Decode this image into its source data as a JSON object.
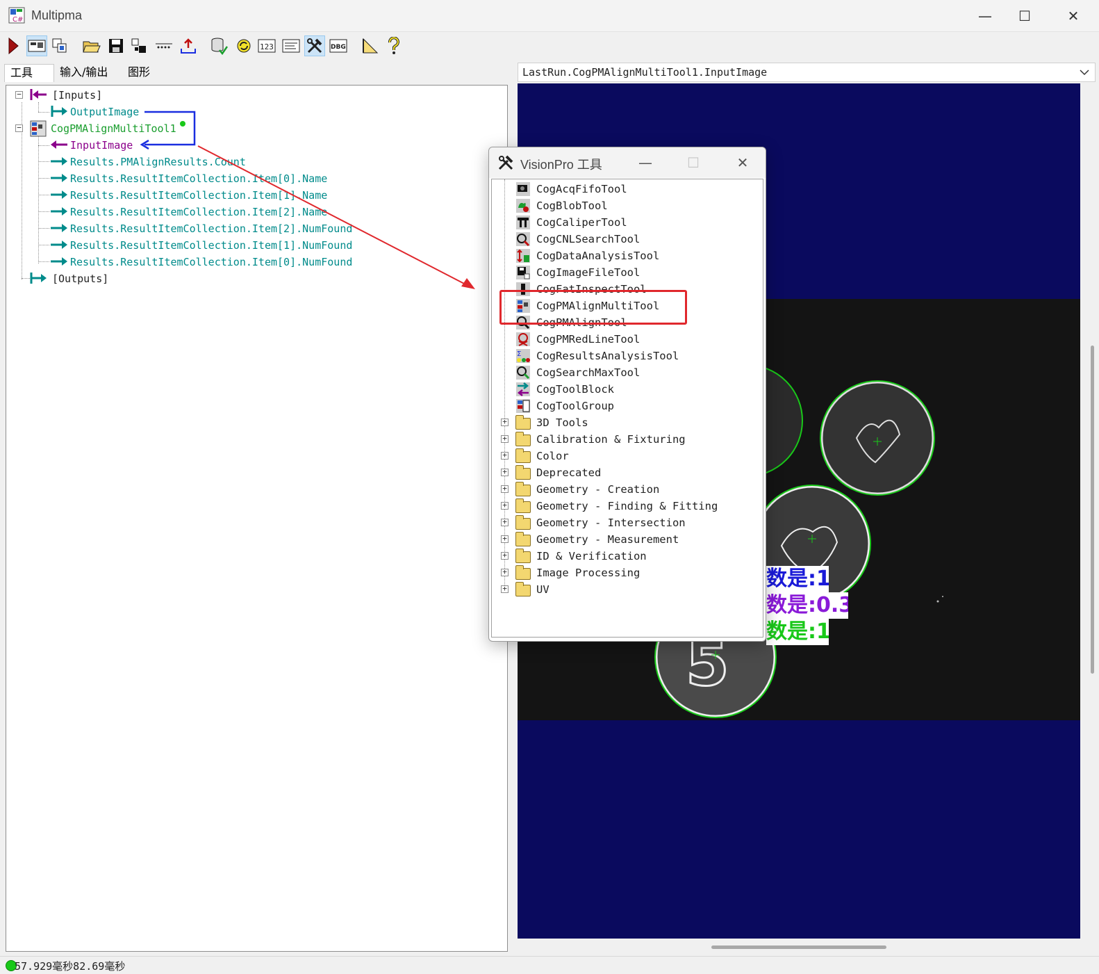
{
  "window": {
    "title": "Multipma",
    "minimize": "—",
    "maximize": "☐",
    "close": "✕"
  },
  "toolbar": {
    "buttons": [
      "run-icon",
      "live-display-icon",
      "copy-icon",
      "open-icon",
      "save-icon",
      "reset-icon",
      "dots-icon",
      "import-icon",
      "database-icon",
      "refresh-icon",
      "number-icon",
      "text-icon",
      "tools-icon",
      "debug-icon",
      "measure-icon",
      "help-icon"
    ],
    "text_123": "123",
    "text_dbg": "DBG"
  },
  "tabs": [
    "工具",
    "输入/输出",
    "图形"
  ],
  "tree": {
    "inputs": "[Inputs]",
    "output_image": "OutputImage",
    "tool": "CogPMAlignMultiTool1",
    "input_image": "InputImage",
    "results": [
      "Results.PMAlignResults.Count",
      "Results.ResultItemCollection.Item[0].Name",
      "Results.ResultItemCollection.Item[1].Name",
      "Results.ResultItemCollection.Item[2].Name",
      "Results.ResultItemCollection.Item[2].NumFound",
      "Results.ResultItemCollection.Item[1].NumFound",
      "Results.ResultItemCollection.Item[0].NumFound"
    ],
    "outputs": "[Outputs]"
  },
  "viewer": {
    "title": "LastRun.CogPMAlignMultiTool1.InputImage",
    "overlay": [
      {
        "text": "数是:1",
        "color": "#1a1ad8"
      },
      {
        "text": "数是:0.3",
        "color": "#8a1ad8"
      },
      {
        "text": "数是:1",
        "color": "#19c819"
      }
    ]
  },
  "status": {
    "text": "57.929毫秒82.69毫秒",
    "color": "#19c819"
  },
  "dialog": {
    "title": "VisionPro 工具",
    "tools": [
      "CogAcqFifoTool",
      "CogBlobTool",
      "CogCaliperTool",
      "CogCNLSearchTool",
      "CogDataAnalysisTool",
      "CogImageFileTool",
      "CogFatInspectTool",
      "CogPMAlignMultiTool",
      "CogPMAlignTool",
      "CogPMRedLineTool",
      "CogResultsAnalysisTool",
      "CogSearchMaxTool",
      "CogToolBlock",
      "CogToolGroup"
    ],
    "folders": [
      "3D Tools",
      "Calibration & Fixturing",
      "Color",
      "Deprecated",
      "Geometry - Creation",
      "Geometry - Finding & Fitting",
      "Geometry - Intersection",
      "Geometry - Measurement",
      "ID & Verification",
      "Image Processing",
      "UV"
    ]
  },
  "colors": {
    "teal": "#008b8b",
    "purple": "#8b008b",
    "highlight": "#e0282d",
    "connector": "#1a2ee0",
    "viewer_bg": "#0a0a5e"
  }
}
